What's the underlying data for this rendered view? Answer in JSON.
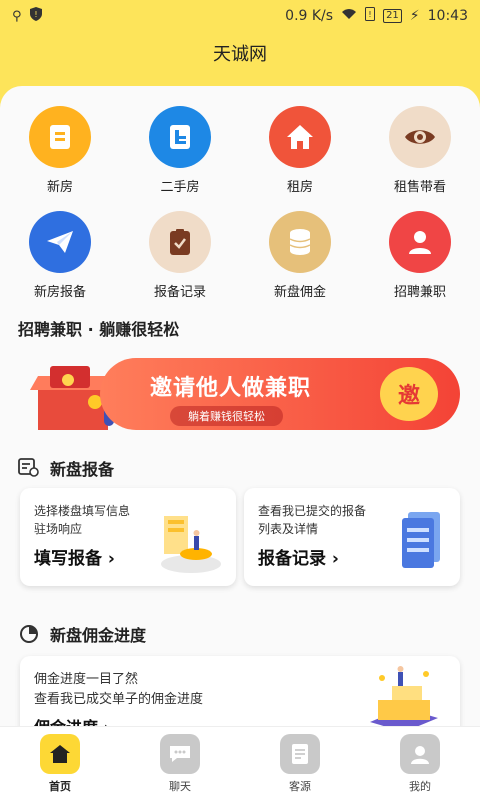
{
  "status": {
    "speed": "0.9 K/s",
    "battery": "21",
    "time": "10:43"
  },
  "title": "天诚网",
  "grid": [
    {
      "label": "新房",
      "icon": "new-house-icon",
      "color": "#ffb21f"
    },
    {
      "label": "二手房",
      "icon": "second-hand-icon",
      "color": "#1e88e5"
    },
    {
      "label": "租房",
      "icon": "home-icon",
      "color": "#f0543a"
    },
    {
      "label": "租售带看",
      "icon": "eye-icon",
      "color": "#f0dcc8"
    },
    {
      "label": "新房报备",
      "icon": "paper-plane-icon",
      "color": "#2f6fe0"
    },
    {
      "label": "报备记录",
      "icon": "clipboard-check-icon",
      "color": "#f0dcc8"
    },
    {
      "label": "新盘佣金",
      "icon": "coins-icon",
      "color": "#e6c07a"
    },
    {
      "label": "招聘兼职",
      "icon": "person-icon",
      "color": "#f04545"
    }
  ],
  "recruit": {
    "title": "招聘兼职 · 躺赚很轻松",
    "banner_main": "邀请他人做兼职",
    "banner_sub": "躺着赚钱很轻松",
    "banner_btn": "邀"
  },
  "report": {
    "title": "新盘报备",
    "cards": [
      {
        "line1": "选择楼盘填写信息",
        "line2": "驻场响应",
        "action": "填写报备 ›"
      },
      {
        "line1": "查看我已提交的报备",
        "line2": "列表及详情",
        "action": "报备记录 ›"
      }
    ]
  },
  "commission": {
    "title": "新盘佣金进度",
    "line1": "佣金进度一目了然",
    "line2": "查看我已成交单子的佣金进度",
    "action": "佣金进度 ›"
  },
  "tabs": [
    {
      "label": "首页",
      "icon": "home-icon"
    },
    {
      "label": "聊天",
      "icon": "chat-icon"
    },
    {
      "label": "客源",
      "icon": "clients-icon"
    },
    {
      "label": "我的",
      "icon": "user-icon"
    }
  ]
}
